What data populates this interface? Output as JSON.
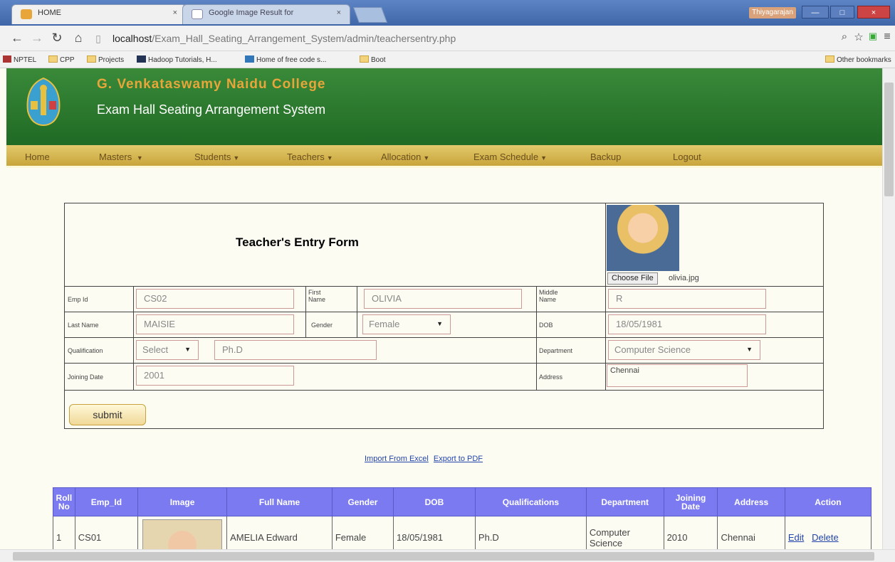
{
  "browser": {
    "tabs": [
      {
        "title": "HOME",
        "close": "×",
        "active": true
      },
      {
        "title": "Google Image Result for",
        "close": "×",
        "active": false
      }
    ],
    "user_badge": "Thiyagarajan",
    "window_controls": {
      "minimize": "—",
      "maximize": "□",
      "close": "×"
    },
    "url_host": "localhost",
    "url_path": "/Exam_Hall_Seating_Arrangement_System/admin/teachersentry.php",
    "bookmarks": [
      "NPTEL",
      "CPP",
      "Projects",
      "Hadoop Tutorials, H...",
      "Home of free code s...",
      "Boot"
    ],
    "other_bookmarks": "Other bookmarks"
  },
  "header": {
    "college": "G. Venkataswamy Naidu College",
    "system": "Exam Hall Seating Arrangement System"
  },
  "menu": [
    "Home",
    "Masters",
    "Students",
    "Teachers",
    "Allocation",
    "Exam Schedule",
    "Backup",
    "Logout"
  ],
  "form": {
    "title": "Teacher's Entry Form",
    "choose_file": "Choose File",
    "file_name": "olivia.jpg",
    "labels": {
      "emp_id": "Emp Id",
      "first_name": "First Name",
      "middle_name": "Middle Name",
      "last_name": "Last Name",
      "gender": "Gender",
      "dob": "DOB",
      "qualification": "Qualification",
      "department": "Department",
      "joining_date": "Joining Date",
      "address": "Address"
    },
    "values": {
      "emp_id": "CS02",
      "first_name": "OLIVIA",
      "middle_name": "R",
      "last_name": "MAISIE",
      "gender": "Female",
      "dob": "18/05/1981",
      "qualification_select": "Select",
      "qualification": "Ph.D",
      "department": "Computer Science",
      "joining_date": "2001",
      "address": "Chennai"
    },
    "submit": "submit"
  },
  "links": {
    "import": "Import From Excel",
    "export": "Export to PDF"
  },
  "table": {
    "headers": [
      "Roll No",
      "Emp_Id",
      "Image",
      "Full Name",
      "Gender",
      "DOB",
      "Qualifications",
      "Department",
      "Joining Date",
      "Address",
      "Action"
    ],
    "rows": [
      {
        "roll": "1",
        "emp_id": "CS01",
        "full_name": "AMELIA Edward",
        "gender": "Female",
        "dob": "18/05/1981",
        "qualification": "Ph.D",
        "department": "Computer Science",
        "joining_date": "2010",
        "address": "Chennai",
        "edit": "Edit",
        "delete": "Delete"
      }
    ]
  }
}
